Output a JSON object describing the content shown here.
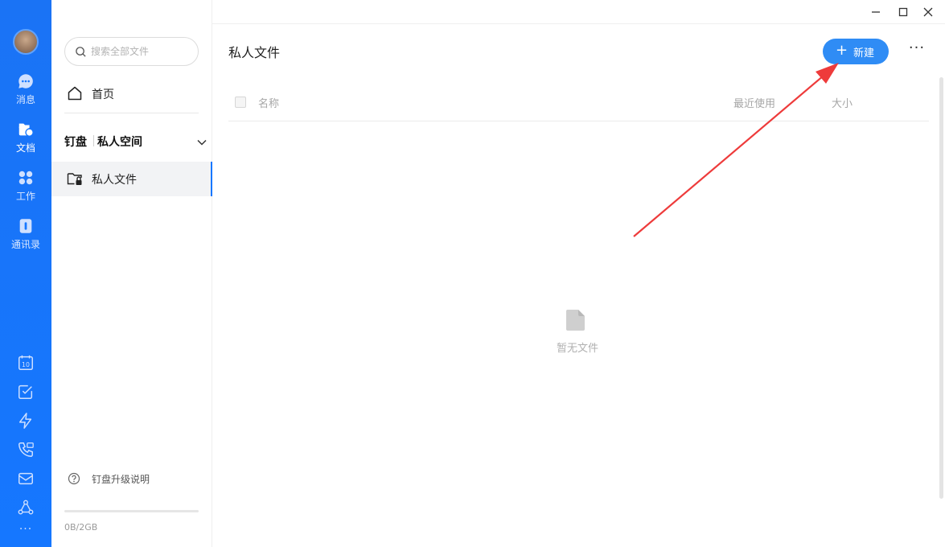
{
  "rail": {
    "items": [
      {
        "label": "消息",
        "icon": "chat-icon"
      },
      {
        "label": "文档",
        "icon": "document-folder-icon"
      },
      {
        "label": "工作",
        "icon": "apps-grid-icon"
      },
      {
        "label": "通讯录",
        "icon": "contacts-book-icon"
      }
    ],
    "calendar_day": "10",
    "tools": [
      "calendar-icon",
      "todo-check-icon",
      "lightning-icon",
      "phone-call-icon",
      "mail-icon",
      "share-nodes-icon",
      "more-icon"
    ],
    "more_label": "···"
  },
  "sidebar": {
    "search_placeholder": "搜索全部文件",
    "home_label": "首页",
    "space_title": "钉盘",
    "space_name": "私人空间",
    "nav_items": [
      {
        "label": "私人文件"
      }
    ],
    "help_label": "钉盘升级说明",
    "storage_text": "0B/2GB",
    "storage_used": 0
  },
  "main": {
    "title": "私人文件",
    "new_button_label": "新建",
    "more_label": "···",
    "columns": {
      "name": "名称",
      "recent": "最近使用",
      "size": "大小"
    },
    "empty_text": "暂无文件"
  },
  "colors": {
    "accent": "#1677ff",
    "button": "#2f8cf5",
    "annotation_arrow": "#ee3b3b"
  }
}
